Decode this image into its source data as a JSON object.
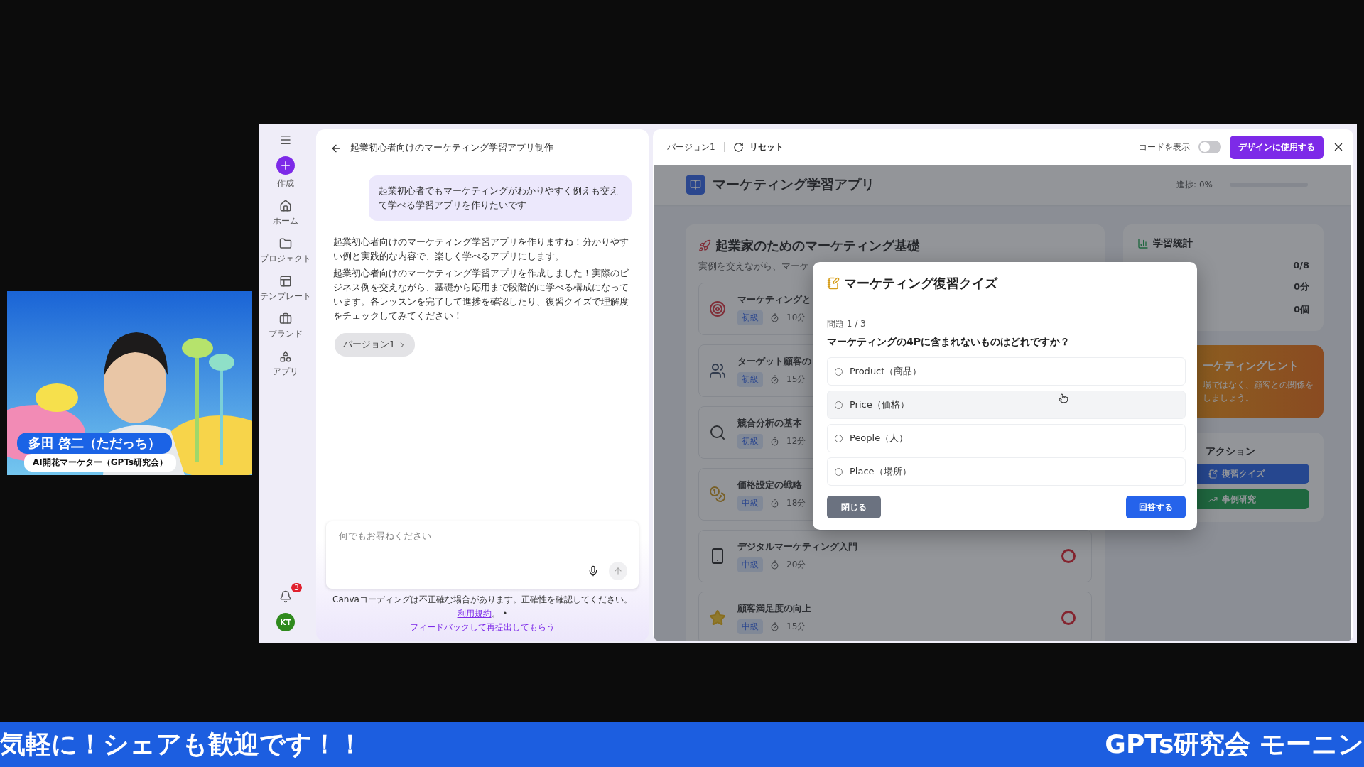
{
  "webcam": {
    "kind": "picture",
    "name": "多田 啓二（ただっち）",
    "role": "AI開花マーケター（GPTs研究会）"
  },
  "rail": {
    "items": [
      {
        "label": "作成",
        "kind": "create"
      },
      {
        "label": "ホーム",
        "kind": "home"
      },
      {
        "label": "プロジェクト",
        "kind": "folder"
      },
      {
        "label": "テンプレート",
        "kind": "template"
      },
      {
        "label": "ブランド",
        "kind": "brand"
      },
      {
        "label": "アプリ",
        "kind": "apps"
      }
    ],
    "notifications": "3",
    "avatar": "KT"
  },
  "chat": {
    "title": "起業初心者向けのマーケティング学習アプリ制作",
    "user_message": "起業初心者でもマーケティングがわかりやすく例えも交えて学べる学習アプリを作りたいです",
    "reply": [
      "起業初心者向けのマーケティング学習アプリを作りますね！分かりやすい例と実践的な内容で、楽しく学べるアプリにします。",
      "起業初心者向けのマーケティング学習アプリを作成しました！実際のビジネス例を交えながら、基礎から応用まで段階的に学べる構成になっています。各レッスンを完了して進捗を確認したり、復習クイズで理解度をチェックしてみてください！"
    ],
    "version_chip": "バージョン1",
    "input": {
      "placeholder": "何でもお尋ねください"
    },
    "disclaimer": "Canvaコーディングは不正確な場合があります。正確性を確認してください。",
    "terms_link": "利用規約",
    "terms_suffix": "。 •",
    "feedback_link": "フィードバックして再提出してもらう"
  },
  "preview": {
    "version": "バージョン1",
    "reset": "リセット",
    "code_toggle": {
      "label": "コードを表示",
      "on": false
    },
    "use_button": "デザインに使用する"
  },
  "app": {
    "title": "マーケティング学習アプリ",
    "progress_label": "進捗: 0%",
    "progress": {
      "level": 0
    },
    "course": {
      "title": "起業家のためのマーケティング基礎",
      "subtitle": "実例を交えながら、マーケ",
      "lessons": [
        {
          "title": "マーケティングと",
          "difficulty": "初級",
          "time": "10分",
          "kind": "target"
        },
        {
          "title": "ターゲット顧客の",
          "difficulty": "初級",
          "time": "15分",
          "kind": "people"
        },
        {
          "title": "競合分析の基本",
          "difficulty": "初級",
          "time": "12分",
          "kind": "search"
        },
        {
          "title": "価格設定の戦略",
          "difficulty": "中級",
          "time": "18分",
          "kind": "money"
        },
        {
          "title": "デジタルマーケティング入門",
          "difficulty": "中級",
          "time": "20分",
          "kind": "phone",
          "completed": false
        },
        {
          "title": "顧客満足度の向上",
          "difficulty": "中級",
          "time": "15分",
          "kind": "star",
          "completed": false
        }
      ]
    },
    "stats": {
      "title": "学習統計",
      "values": [
        "0/8",
        "0分",
        "0個"
      ]
    },
    "hint": {
      "title": "ーケティングヒント",
      "lines": [
        "場ではなく、顧客との関係を",
        "しましょう。"
      ]
    },
    "actions": {
      "title": "アクション",
      "buttons": [
        {
          "label": "復習クイズ",
          "kind": "quiz"
        },
        {
          "label": "事例研究",
          "kind": "case"
        }
      ]
    }
  },
  "quiz": {
    "title": "マーケティング復習クイズ",
    "counter": "問題 1 / 3",
    "question": "マーケティングの4Pに含まれないものはどれですか？",
    "options": [
      {
        "label": "Product（商品）",
        "selected": false,
        "hovered": false
      },
      {
        "label": "Price（価格）",
        "selected": false,
        "hovered": true
      },
      {
        "label": "People（人）",
        "selected": false,
        "hovered": false
      },
      {
        "label": "Place（場所）",
        "selected": false,
        "hovered": false
      }
    ],
    "close": "閉じる",
    "submit": "回答する"
  },
  "ticker": {
    "left": "気軽に！シェアも歓迎です！！",
    "right": "GPTs研究会 モーニン"
  }
}
